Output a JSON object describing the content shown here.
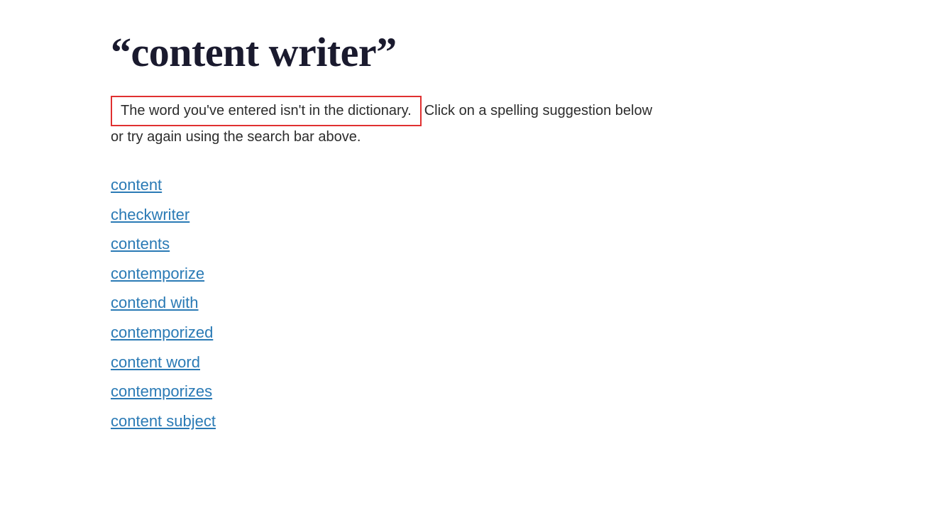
{
  "page": {
    "title": "“content writer”",
    "not_found_text": "The word you've entered isn't in the dictionary.",
    "continuation_text": "Click on a spelling suggestion below or try again using the search bar above.",
    "line2_text": "or try again using the search bar above.",
    "suggestions": [
      "content",
      "checkwriter",
      "contents",
      "contemporize",
      "contend with",
      "contemporized",
      "content word",
      "contemporizes",
      "content subject"
    ]
  }
}
